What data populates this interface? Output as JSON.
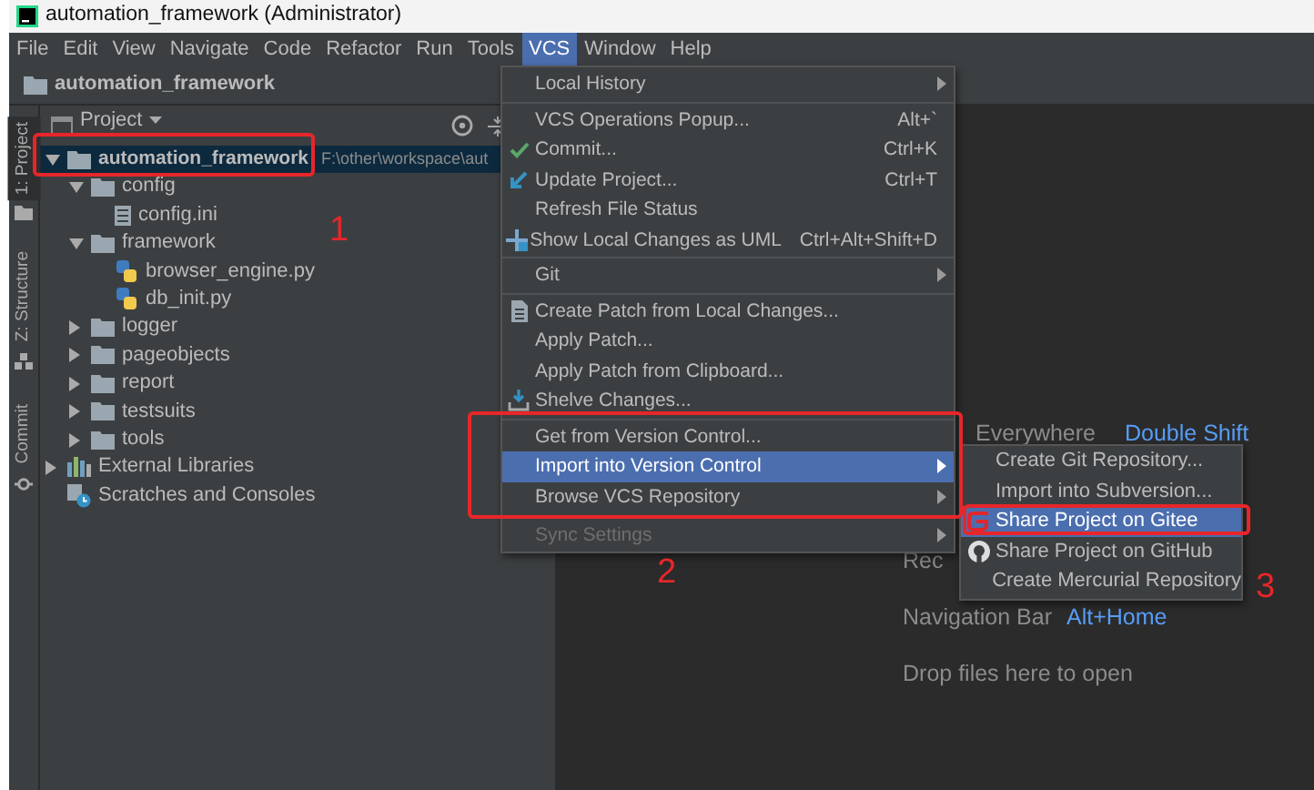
{
  "window": {
    "title": "automation_framework (Administrator)"
  },
  "menu_bar": [
    {
      "label": "File",
      "selected": false
    },
    {
      "label": "Edit",
      "selected": false
    },
    {
      "label": "View",
      "selected": false
    },
    {
      "label": "Navigate",
      "selected": false
    },
    {
      "label": "Code",
      "selected": false
    },
    {
      "label": "Refactor",
      "selected": false
    },
    {
      "label": "Run",
      "selected": false
    },
    {
      "label": "Tools",
      "selected": false
    },
    {
      "label": "VCS",
      "selected": true
    },
    {
      "label": "Window",
      "selected": false
    },
    {
      "label": "Help",
      "selected": false
    }
  ],
  "navigation_bar": {
    "label": "automation_framework"
  },
  "tool_strip": [
    {
      "label": "1: Project",
      "selected": true
    },
    {
      "label": "Z: Structure",
      "selected": false
    },
    {
      "label": "Commit",
      "selected": false
    }
  ],
  "project_panel": {
    "title": "Project",
    "tree": [
      {
        "label": "automation_framework",
        "path": "F:\\other\\workspace\\aut",
        "kind": "folder",
        "expanded": true,
        "selected": true,
        "children": [
          {
            "label": "config",
            "kind": "folder",
            "expanded": true,
            "selected": false,
            "children": [
              {
                "label": "config.ini",
                "kind": "ini",
                "selected": false
              }
            ]
          },
          {
            "label": "framework",
            "kind": "folder",
            "expanded": true,
            "selected": false,
            "children": [
              {
                "label": "browser_engine.py",
                "kind": "python",
                "selected": false
              },
              {
                "label": "db_init.py",
                "kind": "python",
                "selected": false
              }
            ]
          },
          {
            "label": "logger",
            "kind": "folder",
            "expanded": false,
            "selected": false
          },
          {
            "label": "pageobjects",
            "kind": "folder",
            "expanded": false,
            "selected": false
          },
          {
            "label": "report",
            "kind": "folder",
            "expanded": false,
            "selected": false
          },
          {
            "label": "testsuits",
            "kind": "folder",
            "expanded": false,
            "selected": false
          },
          {
            "label": "tools",
            "kind": "folder",
            "expanded": false,
            "selected": false
          }
        ]
      },
      {
        "label": "External Libraries",
        "kind": "library",
        "expanded": false,
        "selected": false
      },
      {
        "label": "Scratches and Consoles",
        "kind": "scratches",
        "selected": false
      }
    ]
  },
  "editor_hints": [
    {
      "label": "Everywhere",
      "shortcut": "Double Shift"
    },
    {
      "label": "Rec"
    },
    {
      "label": "Navigation Bar",
      "shortcut": "Alt+Home"
    },
    {
      "label": "Drop files here to open"
    }
  ],
  "vcs_menu": [
    {
      "kind": "item",
      "label": "Local History",
      "submenu": true,
      "selected": false,
      "disabled": false
    },
    {
      "kind": "separator"
    },
    {
      "kind": "item",
      "label": "VCS Operations Popup...",
      "shortcut": "Alt+`",
      "submenu": false,
      "selected": false,
      "disabled": false
    },
    {
      "kind": "item",
      "label": "Commit...",
      "shortcut": "Ctrl+K",
      "submenu": false,
      "selected": false,
      "disabled": false
    },
    {
      "kind": "item",
      "label": "Update Project...",
      "shortcut": "Ctrl+T",
      "submenu": false,
      "selected": false,
      "disabled": false
    },
    {
      "kind": "item",
      "label": "Refresh File Status",
      "submenu": false,
      "selected": false,
      "disabled": false
    },
    {
      "kind": "item",
      "label": "Show Local Changes as UML",
      "shortcut": "Ctrl+Alt+Shift+D",
      "submenu": false,
      "selected": false,
      "disabled": false
    },
    {
      "kind": "separator"
    },
    {
      "kind": "item",
      "label": "Git",
      "submenu": true,
      "selected": false,
      "disabled": false
    },
    {
      "kind": "separator"
    },
    {
      "kind": "item",
      "label": "Create Patch from Local Changes...",
      "submenu": false,
      "selected": false,
      "disabled": false
    },
    {
      "kind": "item",
      "label": "Apply Patch...",
      "submenu": false,
      "selected": false,
      "disabled": false
    },
    {
      "kind": "item",
      "label": "Apply Patch from Clipboard...",
      "submenu": false,
      "selected": false,
      "disabled": false
    },
    {
      "kind": "item",
      "label": "Shelve Changes...",
      "submenu": false,
      "selected": false,
      "disabled": false
    },
    {
      "kind": "separator"
    },
    {
      "kind": "item",
      "label": "Get from Version Control...",
      "submenu": false,
      "selected": false,
      "disabled": false
    },
    {
      "kind": "item",
      "label": "Import into Version Control",
      "submenu": true,
      "selected": true,
      "disabled": false
    },
    {
      "kind": "item",
      "label": "Browse VCS Repository",
      "submenu": true,
      "selected": false,
      "disabled": false
    },
    {
      "kind": "item",
      "label": "Sync Settings",
      "submenu": true,
      "selected": false,
      "disabled": true
    }
  ],
  "vcs_submenu": [
    {
      "label": "Create Git Repository...",
      "selected": false
    },
    {
      "label": "Import into Subversion...",
      "selected": false
    },
    {
      "label": "Share Project on Gitee",
      "selected": true
    },
    {
      "label": "Share Project on GitHub",
      "selected": false
    },
    {
      "label": "Create Mercurial Repository",
      "selected": false
    }
  ],
  "annotations": [
    {
      "number": "1"
    },
    {
      "number": "2"
    },
    {
      "number": "3"
    }
  ]
}
